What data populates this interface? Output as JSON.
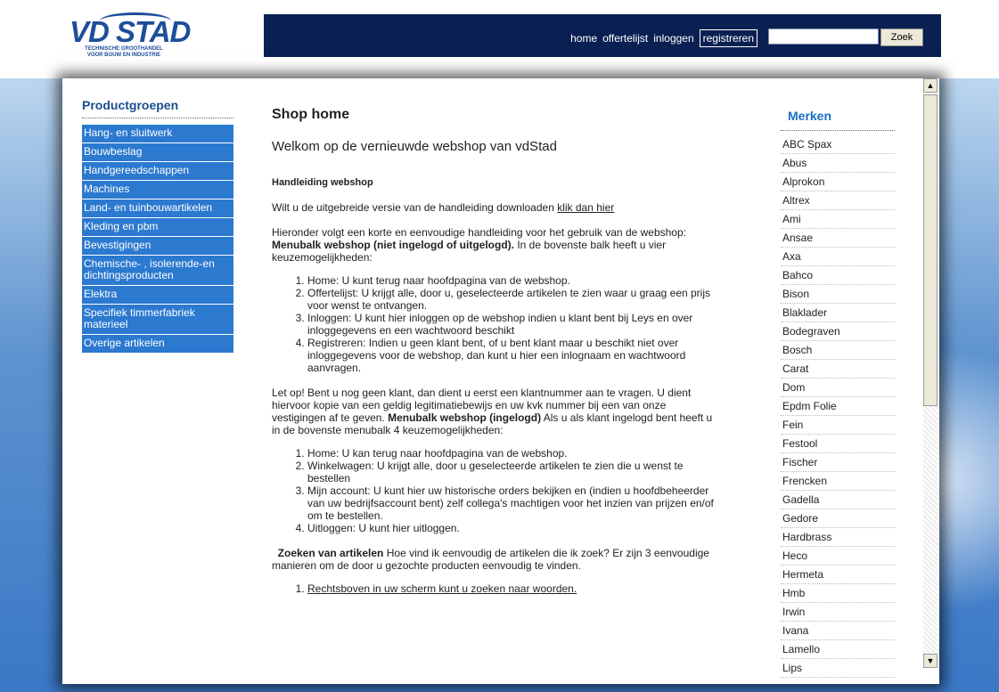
{
  "logo": {
    "brand": "VD STAD",
    "tagline_1": "TECHNISCHE GROOTHANDEL",
    "tagline_2": "VOOR BOUW EN INDUSTRIE"
  },
  "topnav": {
    "home": "home",
    "offertelijst": "offertelijst",
    "inloggen": "inloggen",
    "registreren": "registreren"
  },
  "search": {
    "value": "",
    "button": "Zoek"
  },
  "sidebar": {
    "title": "Productgroepen",
    "items": [
      "Hang- en sluitwerk",
      "Bouwbeslag",
      "Handgereedschappen",
      "Machines",
      "Land- en tuinbouwartikelen",
      "Kleding en pbm",
      "Bevestigingen",
      "Chemische- , isolerende-en dichtingsproducten",
      "Elektra",
      "Specifiek timmerfabriek materieel",
      "Overige artikelen"
    ]
  },
  "main": {
    "title": "Shop home",
    "welcome": "Welkom op de vernieuwde webshop van vdStad",
    "manual_heading": "Handleiding webshop",
    "download_text": "Wilt u de uitgebreide versie van de handleiding downloaden ",
    "download_link": "klik dan hier",
    "intro_1": "Hieronder volgt een korte en eenvoudige handleiding voor het gebruik van de webshop:  ",
    "intro_bold": "Menubalk webshop (niet ingelogd of uitgelogd).",
    "intro_2": " In de bovenste balk heeft u vier keuzemogelijkheden:",
    "list1": [
      "Home: U kunt terug naar hoofdpagina van de webshop.",
      "Offertelijst: U krijgt alle, door u, geselecteerde artikelen te zien waar u graag een prijs voor wenst te ontvangen.",
      "Inloggen: U kunt hier inloggen op de webshop indien u klant bent bij Leys en over inloggegevens en een wachtwoord beschikt",
      "Registreren: Indien u geen klant bent, of u bent klant maar u beschikt niet over inloggegevens voor de webshop, dan kunt u hier een inlognaam en wachtwoord aanvragen."
    ],
    "note_1": "Let op! Bent u nog geen klant, dan dient u eerst een klantnummer aan te vragen. U dient hiervoor kopie van een geldig legitimatiebewijs en uw kvk nummer bij een van onze vestigingen af te geven.  ",
    "note_bold": "Menubalk webshop (ingelogd)",
    "note_2": "  Als u als klant ingelogd bent heeft u in de bovenste menubalk 4 keuzemogelijkheden:",
    "list2": [
      "Home: U kan terug naar hoofdpagina van de webshop.",
      "Winkelwagen: U krijgt alle, door u geselecteerde artikelen te zien die u wenst te bestellen",
      "Mijn account: U kunt hier uw historische orders bekijken en (indien u hoofdbeheerder van uw bedrijfsaccount bent) zelf collega's machtigen voor het inzien van prijzen en/of om te bestellen.",
      "Uitloggen: U kunt hier uitloggen."
    ],
    "search_bold": "Zoeken van artikelen",
    "search_text": "    Hoe vind ik eenvoudig de artikelen die ik zoek?   Er zijn 3 eenvoudige manieren om de door u gezochte producten eenvoudig te vinden.",
    "list3": [
      "Rechtsboven in uw scherm kunt u zoeken naar woorden. "
    ]
  },
  "brands": {
    "title": "Merken",
    "items": [
      "ABC Spax",
      "Abus",
      "Alprokon",
      "Altrex",
      "Ami",
      "Ansae",
      "Axa",
      "Bahco",
      "Bison",
      "Blaklader",
      "Bodegraven",
      "Bosch",
      "Carat",
      "Dom",
      "Epdm Folie",
      "Fein",
      "Festool",
      "Fischer",
      "Frencken",
      "Gadella",
      "Gedore",
      "Hardbrass",
      "Heco",
      "Hermeta",
      "Hmb",
      "Irwin",
      "Ivana",
      "Lamello",
      "Lips"
    ]
  },
  "scrollbar": {
    "up": "▲",
    "down": "▼"
  },
  "colors": {
    "header_bg": "#0a2052",
    "sidebar_item_bg": "#2c79d0",
    "brands_title": "#1a6fc4"
  }
}
